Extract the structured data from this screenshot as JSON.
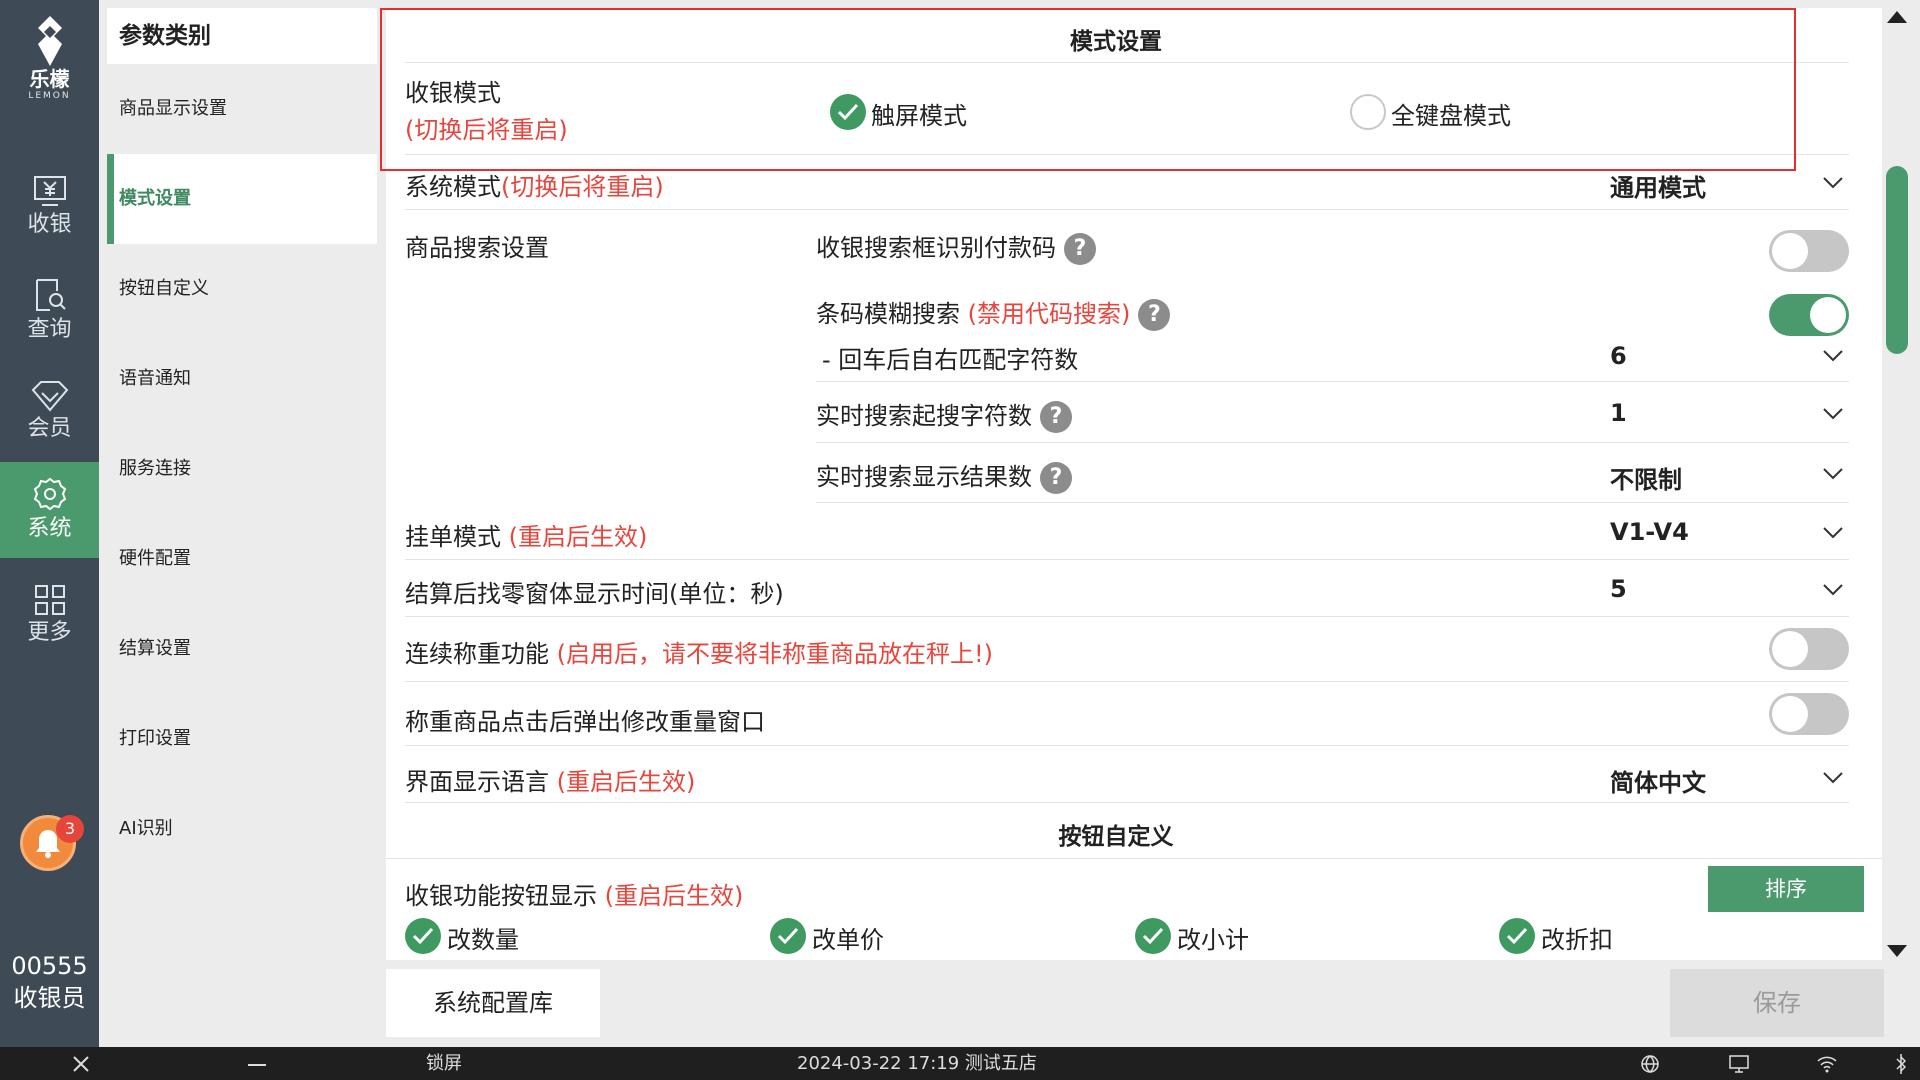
{
  "sidebar": {
    "brand": "乐檬",
    "brand_sub": "LEMON",
    "items": [
      {
        "label": "收银",
        "icon": "cashier-icon"
      },
      {
        "label": "查询",
        "icon": "search-doc-icon"
      },
      {
        "label": "会员",
        "icon": "diamond-icon"
      },
      {
        "label": "系统",
        "icon": "gear-icon",
        "active": true
      },
      {
        "label": "更多",
        "icon": "grid-icon"
      }
    ],
    "notification_count": "3",
    "user_id": "00555",
    "user_role": "收银员"
  },
  "categories": {
    "title": "参数类别",
    "items": [
      "商品显示设置",
      "模式设置",
      "按钮自定义",
      "语音通知",
      "服务连接",
      "硬件配置",
      "结算设置",
      "打印设置",
      "AI识别"
    ],
    "active_index": 1
  },
  "mode_settings": {
    "title": "模式设置",
    "cashier_mode": {
      "label": "收银模式",
      "note": "(切换后将重启)",
      "options": [
        "触屏模式",
        "全键盘模式"
      ],
      "selected": "触屏模式"
    },
    "system_mode": {
      "label": "系统模式",
      "note": "(切换后将重启)",
      "value": "通用模式"
    },
    "product_search": {
      "label": "商品搜索设置",
      "payment_code": {
        "label": "收银搜索框识别付款码",
        "enabled": false
      },
      "fuzzy_barcode": {
        "label": "条码模糊搜索",
        "note": "(禁用代码搜索)",
        "enabled": true
      },
      "match_chars": {
        "label": "- 回车后自右匹配字符数",
        "value": "6"
      },
      "realtime_min_chars": {
        "label": "实时搜索起搜字符数",
        "value": "1"
      },
      "realtime_result_count": {
        "label": "实时搜索显示结果数",
        "value": "不限制"
      }
    },
    "hold_mode": {
      "label": "挂单模式",
      "note": "(重启后生效)",
      "value": "V1-V4"
    },
    "change_window_time": {
      "label": "结算后找零窗体显示时间(单位：秒)",
      "value": "5"
    },
    "continuous_weighing": {
      "label": "连续称重功能",
      "note": "(启用后，请不要将非称重商品放在秤上!)",
      "enabled": false
    },
    "weight_popup": {
      "label": "称重商品点击后弹出修改重量窗口",
      "enabled": false
    },
    "language": {
      "label": "界面显示语言",
      "note": "(重启后生效)",
      "value": "简体中文"
    }
  },
  "button_custom": {
    "title": "按钮自定义",
    "display_label": "收银功能按钮显示",
    "display_note": "(重启后生效)",
    "sort_button": "排序",
    "buttons": [
      "改数量",
      "改单价",
      "改小计",
      "改折扣"
    ]
  },
  "footer": {
    "config_library": "系统配置库",
    "save": "保存"
  },
  "statusbar": {
    "lock": "锁屏",
    "datetime_store": "2024-03-22 17:19 测试五店"
  },
  "colors": {
    "accent": "#4a9a6e",
    "warning_text": "#e8453c",
    "nav_bg": "#3e4a55",
    "highlight_border": "#e62e2e"
  }
}
